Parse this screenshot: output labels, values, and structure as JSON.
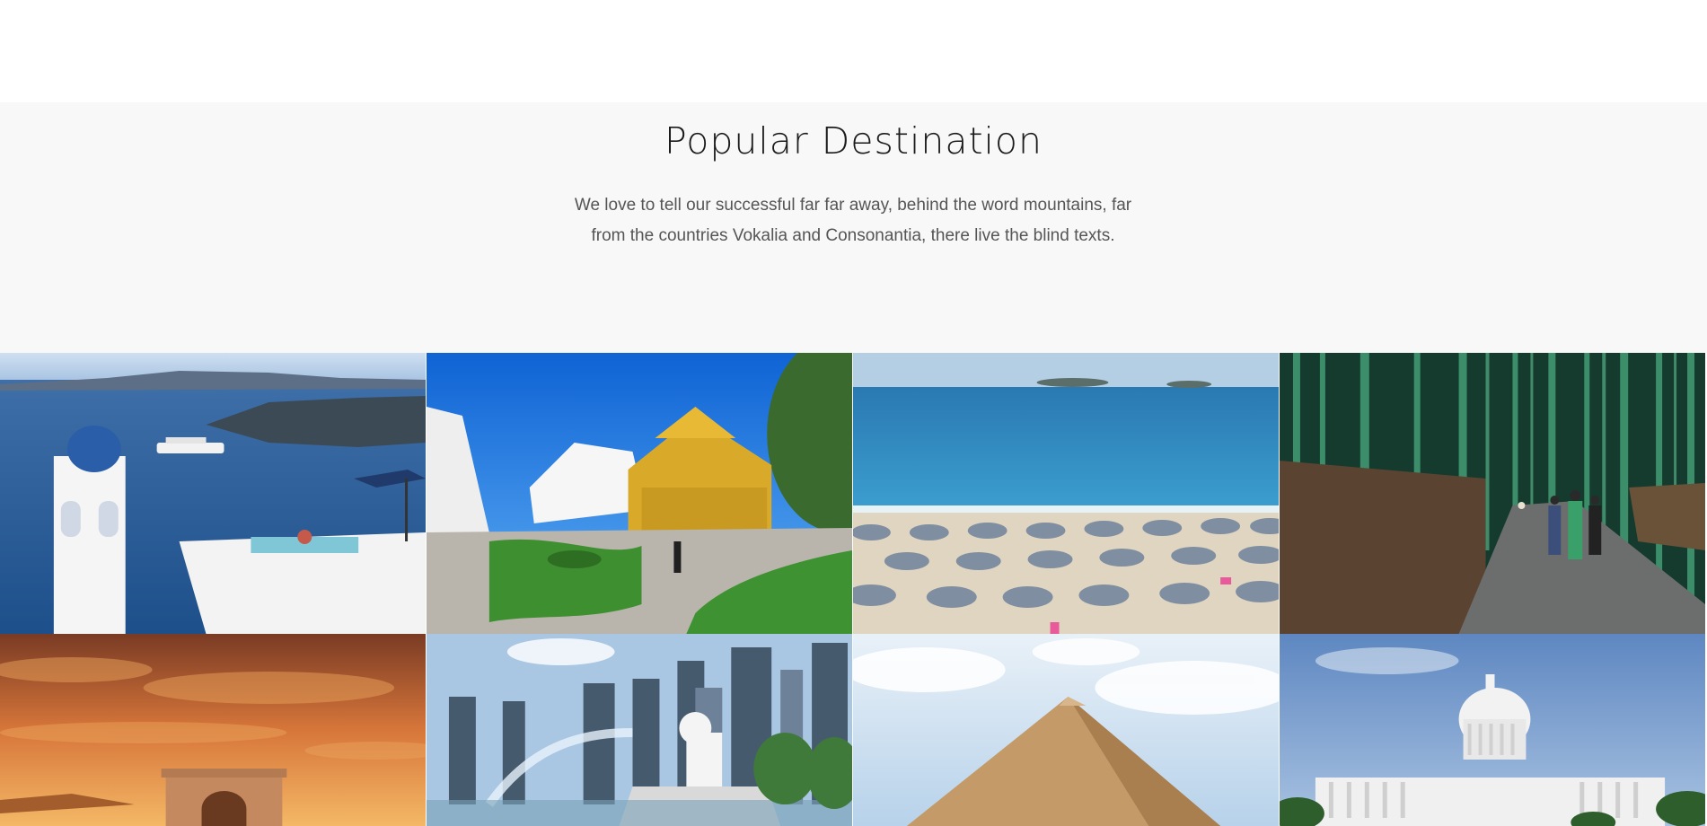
{
  "section": {
    "title": "Popular Destination",
    "description_line1": "We love to tell our successful far far away, behind the word mountains, far",
    "description_line2": "from the countries Vokalia and Consonantia, there live the blind texts."
  },
  "destinations": [
    {
      "scene": "santorini-island"
    },
    {
      "scene": "white-and-golden-temple"
    },
    {
      "scene": "beach-with-parasols"
    },
    {
      "scene": "bamboo-forest-path"
    },
    {
      "scene": "arch-at-sunset"
    },
    {
      "scene": "merlion-city-skyline"
    },
    {
      "scene": "pyramid"
    },
    {
      "scene": "capitol-building"
    }
  ]
}
